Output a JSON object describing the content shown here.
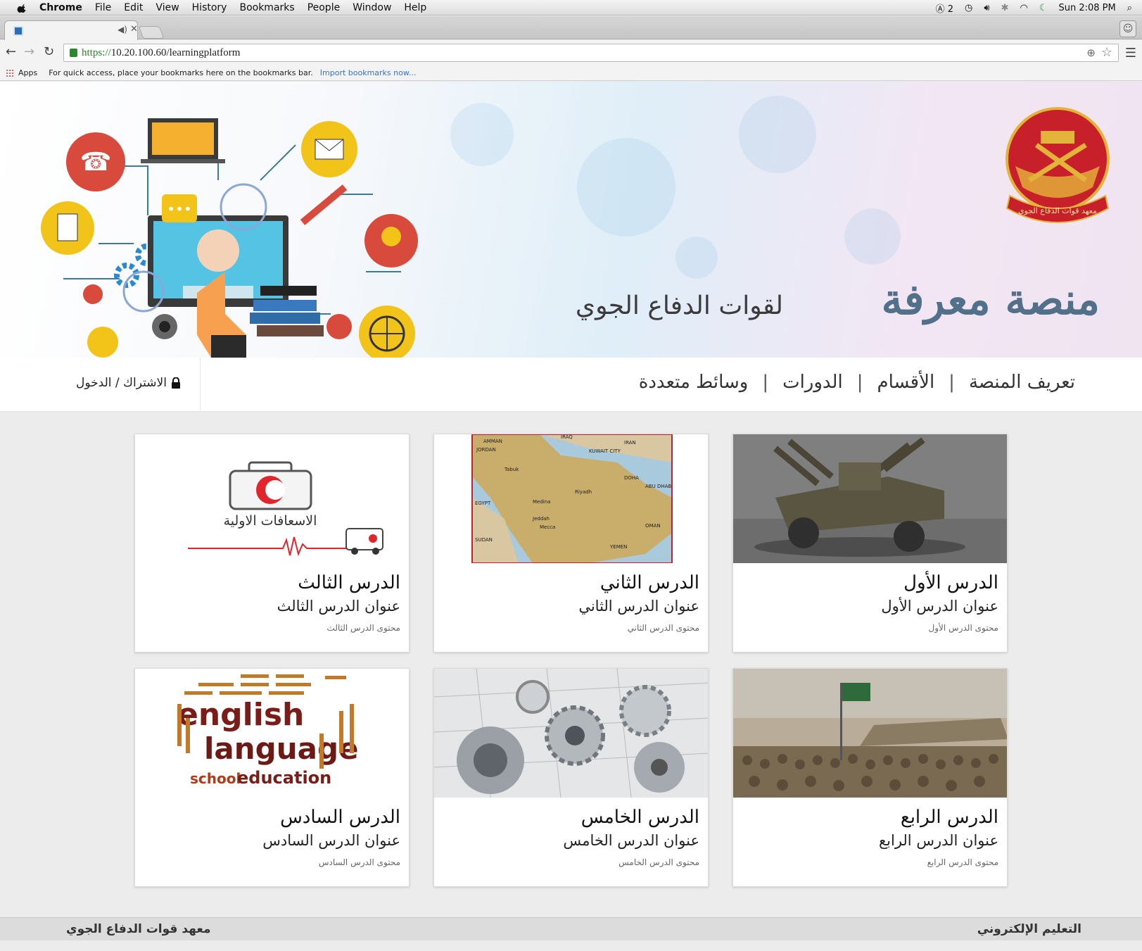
{
  "menubar": {
    "app": "Chrome",
    "items": [
      "File",
      "Edit",
      "View",
      "History",
      "Bookmarks",
      "People",
      "Window",
      "Help"
    ],
    "status_count": "2",
    "clock": "Sun 2:08 PM"
  },
  "browser": {
    "url_scheme": "https://",
    "url_rest": "10.20.100.60/learningplatform",
    "bookmarks": {
      "apps": "Apps",
      "hint": "For quick access, place your bookmarks here on the bookmarks bar.",
      "import_link": "Import bookmarks now..."
    }
  },
  "banner": {
    "title": "منصة معرفة",
    "subtitle": "لقوات الدفاع الجوي",
    "emblem_text": "معهد قوات الدفاع الجوي"
  },
  "nav": {
    "links": [
      "تعريف المنصة",
      "الأقسام",
      "الدورات",
      "وسائط متعددة"
    ],
    "separator": "|",
    "login": "الاشتراك / الدخول"
  },
  "lessons": [
    {
      "title": "الدرس الأول",
      "subtitle": "عنوان الدرس الأول",
      "content": "محتوى الدرس الأول",
      "image": "anti-aircraft-gun"
    },
    {
      "title": "الدرس الثاني",
      "subtitle": "عنوان الدرس الثاني",
      "content": "محتوى الدرس الثاني",
      "image": "arabian-peninsula-map"
    },
    {
      "title": "الدرس الثالث",
      "subtitle": "عنوان الدرس الثالث",
      "content": "محتوى الدرس الثالث",
      "image": "first-aid-kit",
      "image_caption": "الاسعافات الاولية"
    },
    {
      "title": "الدرس الرابع",
      "subtitle": "عنوان الدرس الرابع",
      "content": "محتوى الدرس الرابع",
      "image": "military-parade"
    },
    {
      "title": "الدرس الخامس",
      "subtitle": "عنوان الدرس الخامس",
      "content": "محتوى الدرس الخامس",
      "image": "machine-gears"
    },
    {
      "title": "الدرس السادس",
      "subtitle": "عنوان الدرس السادس",
      "content": "محتوى الدرس السادس",
      "image": "english-word-cloud",
      "image_words": {
        "big1": "english",
        "big2": "language",
        "big3": "school",
        "big4": "education"
      }
    }
  ],
  "map_labels": [
    "IRAQ",
    "IRAN",
    "KUWAIT CITY",
    "JORDAN",
    "AMMAN",
    "Tabuk",
    "Riyadh",
    "DOHA",
    "ABU DHABI",
    "Medina",
    "Jeddah",
    "Mecca",
    "SUDAN",
    "YEMEN",
    "OMAN",
    "EGYPT"
  ],
  "footer": {
    "right": "التعليم الإلكتروني",
    "left": "معهد قوات الدفاع الجوي"
  },
  "colors": {
    "title_blue": "#52708a",
    "emblem_red": "#c8202a",
    "emblem_gold": "#e3b43a",
    "link_blue": "#3b72c4",
    "url_green": "#1f8a1f"
  }
}
